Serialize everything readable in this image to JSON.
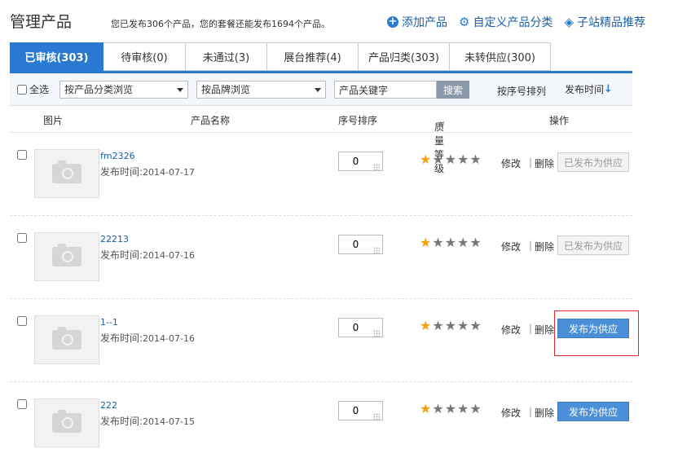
{
  "header": {
    "title": "管理产品",
    "summary": "您已发布306个产品，您的套餐还能发布1694个产品。",
    "links": {
      "add_product": "添加产品",
      "custom_category": "自定义产品分类",
      "featured": "子站精品推荐"
    }
  },
  "tabs": [
    {
      "label": "已审核(303)",
      "active": true
    },
    {
      "label": "待审核(0)",
      "active": false
    },
    {
      "label": "未通过(3)",
      "active": false
    },
    {
      "label": "展台推荐(4)",
      "active": false
    },
    {
      "label": "产品归类(303)",
      "active": false
    },
    {
      "label": "未转供应(300)",
      "active": false
    }
  ],
  "filters": {
    "select_all": "全选",
    "category_browse": "按产品分类浏览",
    "brand_browse": "按品牌浏览",
    "keyword_value": "产品关键字",
    "search_button": "搜索",
    "sort_by_seq": "按序号排列",
    "sort_by_time": "发布时间"
  },
  "columns": {
    "image": "图片",
    "name": "产品名称",
    "seq": "序号排序",
    "quality": "质量等级",
    "action": "操作"
  },
  "row_labels": {
    "publish_time_label": "发布时间:",
    "edit": "修改",
    "delete": "删除",
    "separator": "|"
  },
  "products": [
    {
      "name": "fm2326",
      "date": "2014-07-17",
      "seq": "0",
      "stars": 1,
      "action": "已发布为供应",
      "state": "done"
    },
    {
      "name": "22213",
      "date": "2014-07-16",
      "seq": "0",
      "stars": 1,
      "action": "已发布为供应",
      "state": "done"
    },
    {
      "name": "1--1",
      "date": "2014-07-16",
      "seq": "0",
      "stars": 1,
      "action": "发布为供应",
      "state": "primary"
    },
    {
      "name": "222",
      "date": "2014-07-15",
      "seq": "0",
      "stars": 1,
      "action": "发布为供应",
      "state": "primary"
    }
  ],
  "colors": {
    "accent": "#2a7ad1",
    "star_on": "#f2a20d",
    "star_off": "#777777",
    "highlight": "#d9292b"
  }
}
